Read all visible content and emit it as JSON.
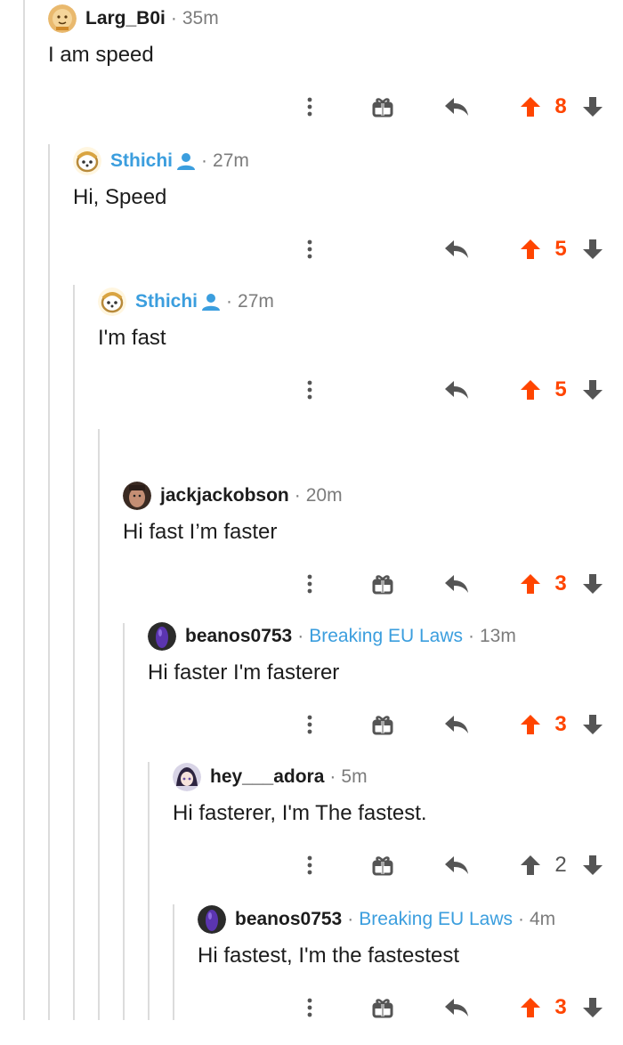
{
  "comments": [
    {
      "username": "Larg_B0i",
      "age": "35m",
      "body": "I am speed",
      "score": "8",
      "upvoted": true,
      "op": false,
      "flair": "",
      "award": true,
      "avatar": "lion"
    },
    {
      "username": "Sthichi",
      "age": "27m",
      "body": "Hi, Speed",
      "score": "5",
      "upvoted": true,
      "op": true,
      "flair": "",
      "award": false,
      "avatar": "doodle"
    },
    {
      "username": "Sthichi",
      "age": "27m",
      "body": "I'm fast",
      "score": "5",
      "upvoted": true,
      "op": true,
      "flair": "",
      "award": false,
      "avatar": "doodle"
    },
    {
      "username": "jackjackobson",
      "age": "20m",
      "body": "Hi fast I’m faster",
      "score": "3",
      "upvoted": true,
      "op": false,
      "flair": "",
      "award": true,
      "avatar": "face"
    },
    {
      "username": "beanos0753",
      "age": "13m",
      "body": "Hi faster I'm fasterer",
      "score": "3",
      "upvoted": true,
      "op": false,
      "flair": "Breaking EU Laws",
      "award": true,
      "avatar": "bean"
    },
    {
      "username": "hey___adora",
      "age": "5m",
      "body": "Hi fasterer, I'm The fastest.",
      "score": "2",
      "upvoted": false,
      "op": false,
      "flair": "",
      "award": true,
      "avatar": "anime"
    },
    {
      "username": "beanos0753",
      "age": "4m",
      "body": "Hi fastest, I'm the fastestest",
      "score": "3",
      "upvoted": true,
      "op": false,
      "flair": "Breaking EU Laws",
      "award": true,
      "avatar": "bean"
    }
  ],
  "colors": {
    "upvote": "#ff4500",
    "op": "#3b9ede",
    "meta": "#7c7c7c",
    "line": "#dcdcdc"
  },
  "icons": {
    "more": "vertical-dots-icon",
    "award": "gift-award-icon",
    "reply": "reply-arrow-icon",
    "up": "upvote-arrow-icon",
    "down": "downvote-arrow-icon",
    "op": "op-person-icon"
  }
}
